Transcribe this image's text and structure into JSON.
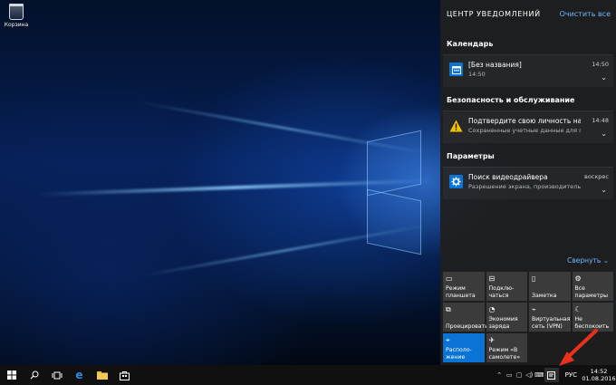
{
  "desktop": {
    "icon_label": "Корзина"
  },
  "action_center": {
    "title": "ЦЕНТР УВЕДОМЛЕНИЙ",
    "clear_all": "Очистить все",
    "groups": [
      {
        "name": "Календарь",
        "notification": {
          "title": "[Без названия]",
          "subtitle": "14:50",
          "time": "14:50",
          "icon": "calendar-icon",
          "icon_color": "#0a74d6"
        }
      },
      {
        "name": "Безопасность и обслуживание",
        "notification": {
          "title": "Подтвердите свою личность на эт",
          "subtitle": "Сохраненные учетные данные для при",
          "time": "14:48",
          "icon": "warning-icon",
          "icon_color": "#f2c200"
        }
      },
      {
        "name": "Параметры",
        "notification": {
          "title": "Поиск видеодрайвера",
          "subtitle": "Разрешение экрана, производительно",
          "time": "воскрес",
          "icon": "gear-icon",
          "icon_color": "#0a74d6"
        }
      }
    ],
    "collapse": "Свернуть",
    "tiles": [
      {
        "label": "Режим планшета",
        "icon": "tablet-mode-icon",
        "active": false
      },
      {
        "label": "Подклю-чаться",
        "icon": "connect-icon",
        "active": false
      },
      {
        "label": "Заметка",
        "icon": "note-icon",
        "active": false
      },
      {
        "label": "Все параметры",
        "icon": "gear-icon",
        "active": false
      },
      {
        "label": "Проецировать",
        "icon": "project-icon",
        "active": false
      },
      {
        "label": "Экономия заряда",
        "icon": "battery-saver-icon",
        "active": false
      },
      {
        "label": "Виртуальная сеть (VPN)",
        "icon": "vpn-icon",
        "active": false
      },
      {
        "label": "Не беспокоить",
        "icon": "moon-icon",
        "active": false
      },
      {
        "label": "Располо-жение",
        "icon": "location-icon",
        "active": true
      },
      {
        "label": "Режим «В самолете»",
        "icon": "airplane-icon",
        "active": false
      }
    ],
    "accent": "#0a74d6"
  },
  "taskbar": {
    "language": "РУС",
    "time": "14:52",
    "date": "01.08.2016"
  },
  "annotation": {
    "arrow_color": "#e8301c"
  }
}
